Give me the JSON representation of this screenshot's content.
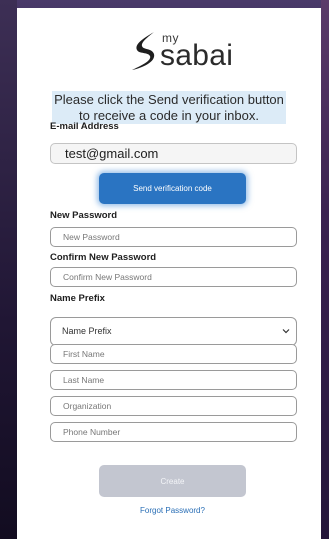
{
  "brand": {
    "logo_small": "my",
    "logo_name": "sabai",
    "accent_color": "#2a74c2"
  },
  "info": {
    "message": "Please click the Send verification button to receive a code in your inbox."
  },
  "email": {
    "label": "E-mail Address",
    "value": "test@gmail.com"
  },
  "send_button": {
    "label": "Send verification code"
  },
  "new_password": {
    "label": "New Password",
    "placeholder": "New Password"
  },
  "confirm_password": {
    "label": "Confirm New Password",
    "placeholder": "Confirm New Password"
  },
  "name_prefix": {
    "label": "Name Prefix",
    "selected": "Name Prefix"
  },
  "first_name": {
    "placeholder": "First Name"
  },
  "last_name": {
    "placeholder": "Last Name"
  },
  "organization": {
    "placeholder": "Organization"
  },
  "phone": {
    "placeholder": "Phone Number"
  },
  "create_button": {
    "label": "Create"
  },
  "forgot_link": {
    "label": "Forgot Password?"
  }
}
